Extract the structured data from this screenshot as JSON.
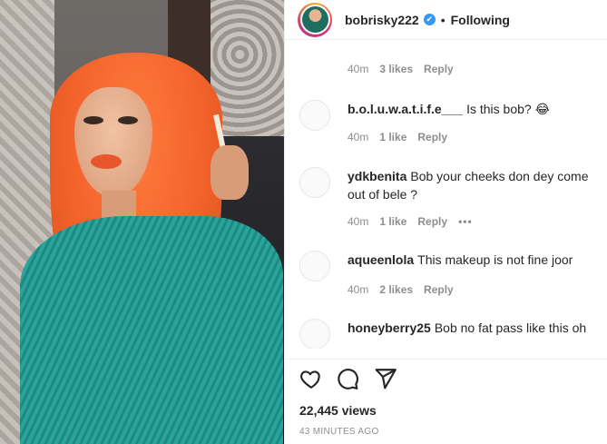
{
  "post": {
    "username": "bobrisky222",
    "separator": "•",
    "follow_status": "Following",
    "verified_mark": "✔"
  },
  "comments": [
    {
      "username": "",
      "text": "",
      "time": "40m",
      "likes": "3 likes",
      "reply": "Reply"
    },
    {
      "username": "b.o.l.u.w.a.t.i.f.e___",
      "text": "Is this bob? 😂",
      "time": "40m",
      "likes": "1 like",
      "reply": "Reply"
    },
    {
      "username": "ydkbenita",
      "text": "Bob your cheeks don dey come out of bele ?",
      "time": "40m",
      "likes": "1 like",
      "reply": "Reply",
      "more": "•••"
    },
    {
      "username": "aqueenlola",
      "text": "This makeup is not fine joor",
      "time": "40m",
      "likes": "2 likes",
      "reply": "Reply"
    },
    {
      "username": "honeyberry25",
      "text": "Bob no fat pass like this oh"
    }
  ],
  "footer": {
    "views": "22,445 views",
    "timestamp": "43 MINUTES AGO"
  },
  "icons": [
    "heart-icon",
    "comment-icon",
    "share-icon",
    "verified-badge-icon"
  ]
}
